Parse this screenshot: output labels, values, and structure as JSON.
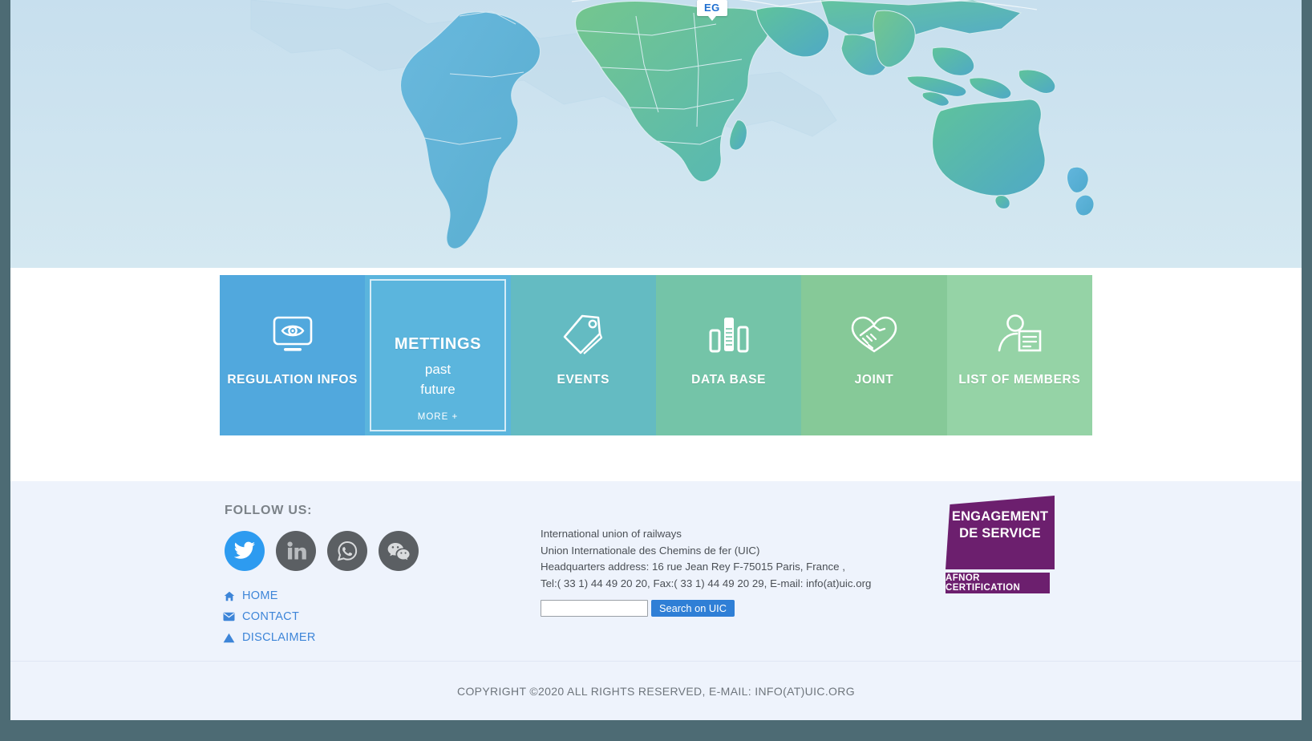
{
  "map": {
    "tooltip_label": "EG",
    "ocean_color": "#cfe3ef",
    "land_green": "#6cbf8b",
    "land_teal": "#56b4c0",
    "land_blue": "#5ab3d6"
  },
  "tiles": [
    {
      "label": "REGULATION INFOS",
      "icon": "eye-monitor-icon",
      "color": "#51a8dd"
    },
    {
      "label": "METTINGS",
      "icon": "none",
      "color": "#5bb5dd",
      "sub_line1": "past",
      "sub_line2": "future",
      "more_label": "MORE +"
    },
    {
      "label": "EVENTS",
      "icon": "tag-icon",
      "color": "#64bbc2"
    },
    {
      "label": "DATA BASE",
      "icon": "bar-chart-icon",
      "color": "#74c4a8"
    },
    {
      "label": "JOINT",
      "icon": "handshake-heart-icon",
      "color": "#86c998"
    },
    {
      "label": "LIST OF MEMBERS",
      "icon": "person-list-icon",
      "color": "#95d3a6"
    }
  ],
  "footer": {
    "follow_title": "FOLLOW US:",
    "social": [
      {
        "name": "twitter",
        "color": "#2d9bf0"
      },
      {
        "name": "linkedin",
        "color": "#5b5f63"
      },
      {
        "name": "whatsapp",
        "color": "#5b5f63"
      },
      {
        "name": "wechat",
        "color": "#5b5f63"
      }
    ],
    "links": [
      {
        "label": "HOME",
        "icon": "home-icon"
      },
      {
        "label": "CONTACT",
        "icon": "envelope-icon"
      },
      {
        "label": "DISCLAIMER",
        "icon": "warning-triangle-icon"
      }
    ],
    "address": [
      "International union of railways",
      "Union Internationale des Chemins de fer (UIC)",
      "Headquarters address: 16 rue Jean Rey F-75015 Paris, France ,",
      "Tel:( 33 1) 44 49 20 20, Fax:( 33 1) 44 49 20 29, E-mail: info(at)uic.org"
    ],
    "search": {
      "value": "",
      "placeholder": "",
      "button_label": "Search on UIC"
    },
    "afnor": {
      "line1": "ENGAGEMENT",
      "line2": "DE SERVICE",
      "bar": "AFNOR CERTIFICATION",
      "color": "#6c1f6e"
    },
    "copyright": "COPYRIGHT ©2020  ALL RIGHTS RESERVED, E-MAIL: INFO(AT)UIC.ORG"
  }
}
